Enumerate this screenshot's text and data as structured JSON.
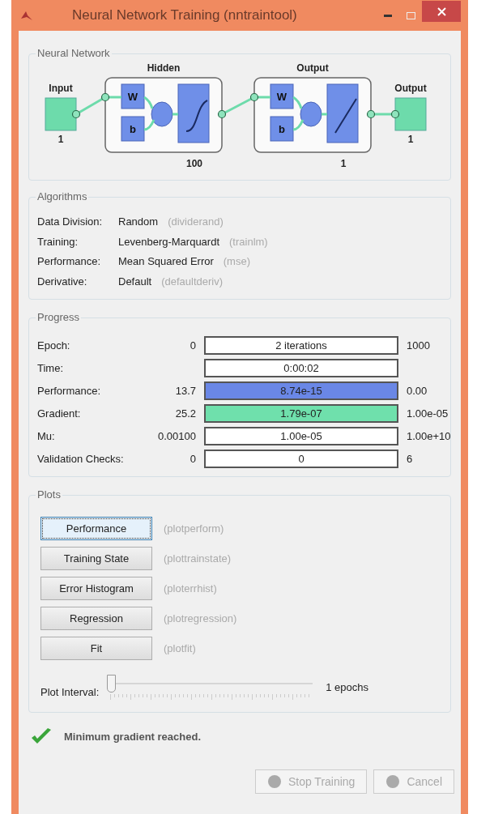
{
  "window": {
    "title": "Neural Network Training (nntraintool)"
  },
  "network": {
    "title": "Neural Network",
    "input": {
      "label": "Input",
      "size": "1"
    },
    "layers": [
      {
        "title": "Hidden",
        "size": "100",
        "weight_label": "W",
        "bias_label": "b",
        "kind": "sigmoid"
      },
      {
        "title": "Output",
        "size": "1",
        "weight_label": "W",
        "bias_label": "b",
        "kind": "linear"
      }
    ],
    "output": {
      "label": "Output",
      "size": "1"
    }
  },
  "algorithms": {
    "title": "Algorithms",
    "rows": [
      {
        "label": "Data Division:",
        "value": "Random",
        "function": "(dividerand)"
      },
      {
        "label": "Training:",
        "value": "Levenberg-Marquardt",
        "function": "(trainlm)"
      },
      {
        "label": "Performance:",
        "value": "Mean Squared Error",
        "function": "(mse)"
      },
      {
        "label": "Derivative:",
        "value": "Default",
        "function": "(defaultderiv)"
      }
    ]
  },
  "progress": {
    "title": "Progress",
    "rows": [
      {
        "label": "Epoch:",
        "start": "0",
        "value": "2 iterations",
        "end": "1000"
      },
      {
        "label": "Time:",
        "value": "0:00:02"
      },
      {
        "label": "Performance:",
        "start": "13.7",
        "value": "8.74e-15",
        "end": "0.00",
        "color": "#6a87e6"
      },
      {
        "label": "Gradient:",
        "start": "25.2",
        "value": "1.79e-07",
        "end": "1.00e-05",
        "color": "#6fe0ac"
      },
      {
        "label": "Mu:",
        "start": "0.00100",
        "value": "1.00e-05",
        "end": "1.00e+10"
      },
      {
        "label": "Validation Checks:",
        "start": "0",
        "value": "0",
        "end": "6"
      }
    ]
  },
  "plots": {
    "title": "Plots",
    "buttons": [
      {
        "label": "Performance",
        "function": "(plotperform)",
        "selected": true
      },
      {
        "label": "Training State",
        "function": "(plottrainstate)",
        "selected": false
      },
      {
        "label": "Error Histogram",
        "function": "(ploterrhist)",
        "selected": false
      },
      {
        "label": "Regression",
        "function": "(plotregression)",
        "selected": false
      },
      {
        "label": "Fit",
        "function": "(plotfit)",
        "selected": false
      }
    ],
    "interval": {
      "label": "Plot Interval:",
      "level": 0,
      "reading": "1 epochs"
    }
  },
  "status": {
    "message": "Minimum gradient reached."
  },
  "buttons": [
    {
      "label": "Stop Training",
      "disabled": true
    },
    {
      "label": "Cancel",
      "disabled": true
    }
  ]
}
